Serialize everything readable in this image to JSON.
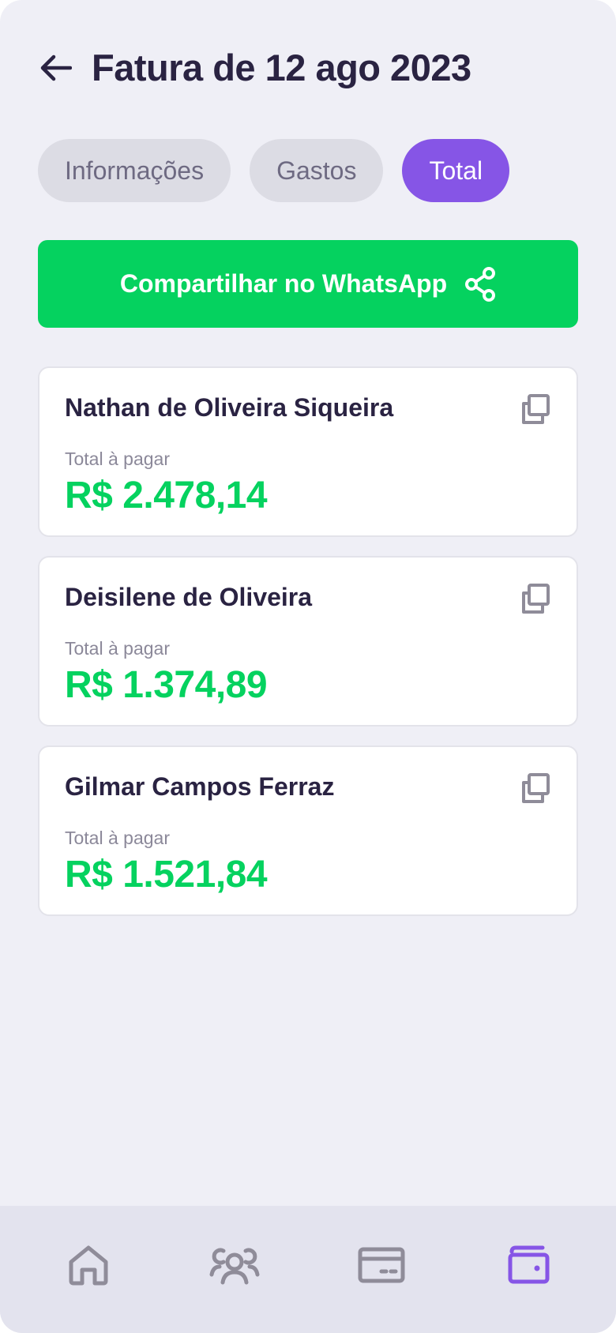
{
  "header": {
    "title": "Fatura de 12 ago 2023",
    "back_icon": "arrow-left-icon"
  },
  "tabs": [
    {
      "label": "Informações",
      "active": false
    },
    {
      "label": "Gastos",
      "active": false
    },
    {
      "label": "Total",
      "active": true
    }
  ],
  "share": {
    "label": "Compartilhar no WhatsApp",
    "icon": "share-icon"
  },
  "cards": [
    {
      "name": "Nathan de Oliveira Siqueira",
      "subtitle": "Total à pagar",
      "amount": "R$ 2.478,14"
    },
    {
      "name": "Deisilene de Oliveira",
      "subtitle": "Total à pagar",
      "amount": "R$ 1.374,89"
    },
    {
      "name": "Gilmar Campos Ferraz",
      "subtitle": "Total à pagar",
      "amount": "R$ 1.521,84"
    }
  ],
  "bottom_nav": {
    "items": [
      {
        "icon": "home-icon",
        "active": false
      },
      {
        "icon": "people-icon",
        "active": false
      },
      {
        "icon": "card-icon",
        "active": false
      },
      {
        "icon": "wallet-icon",
        "active": true
      }
    ]
  },
  "colors": {
    "background": "#efeff6",
    "title": "#2a2342",
    "accent": "#8655e6",
    "success": "#05d25f",
    "muted": "#8b8899",
    "inactive_icon": "#8f8c99"
  }
}
